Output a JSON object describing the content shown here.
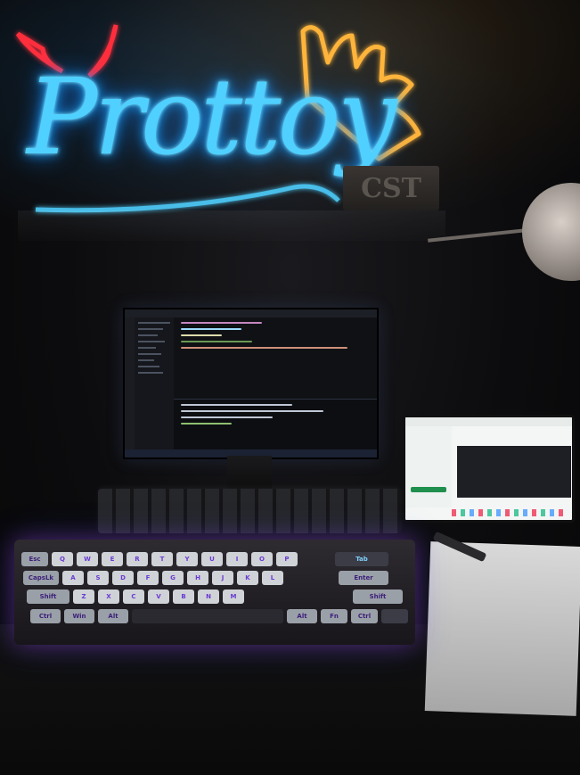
{
  "scene": {
    "type": "photo",
    "neon_sign_text": "Prottoy",
    "desk_block_text": "CST",
    "icons": [
      "devil-horns-icon",
      "crown-icon"
    ],
    "keyboard": {
      "legends": [
        "Esc",
        "Q",
        "W",
        "E",
        "R",
        "T",
        "Y",
        "U",
        "I",
        "O",
        "P",
        "Tab",
        "CapsLk",
        "A",
        "S",
        "D",
        "F",
        "G",
        "H",
        "J",
        "K",
        "L",
        "Enter",
        "Shift",
        "Z",
        "X",
        "C",
        "V",
        "B",
        "N",
        "M",
        "Shift",
        "Ctrl",
        "Win",
        "Alt",
        "Alt",
        "Fn",
        "Ctrl"
      ]
    },
    "colors": {
      "neon_blue": "#4fd0ff",
      "neon_red": "#ff2f3c",
      "neon_orange": "#ffb43a"
    }
  }
}
